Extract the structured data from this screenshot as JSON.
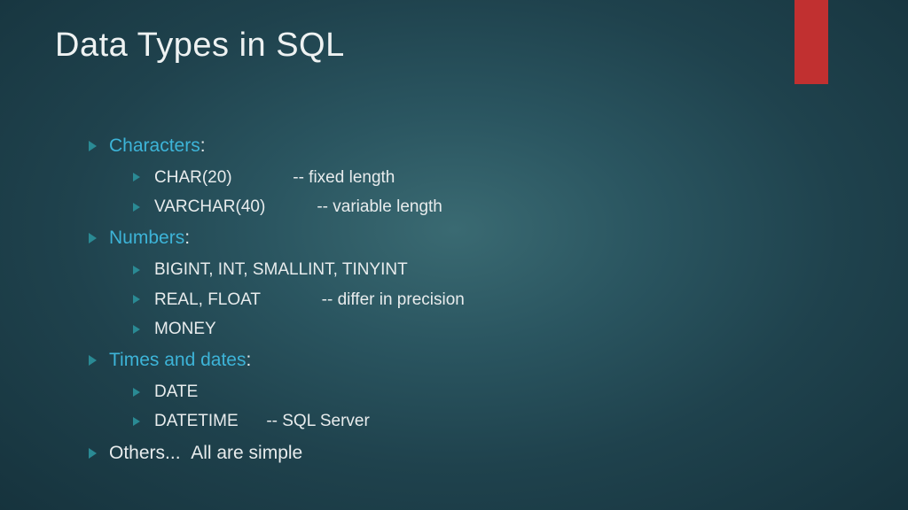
{
  "title": "Data Types in SQL",
  "sections": [
    {
      "heading": "Characters",
      "colon": ":",
      "items": [
        "CHAR(20)             -- fixed length",
        "VARCHAR(40)           -- variable length"
      ]
    },
    {
      "heading": "Numbers",
      "colon": ":",
      "items": [
        "BIGINT, INT, SMALLINT, TINYINT",
        "REAL, FLOAT             -- differ in precision",
        "MONEY"
      ]
    },
    {
      "heading": "Times and dates",
      "colon": ":",
      "items": [
        "DATE",
        "DATETIME      -- SQL Server"
      ]
    }
  ],
  "footer": "Others...  All are simple"
}
